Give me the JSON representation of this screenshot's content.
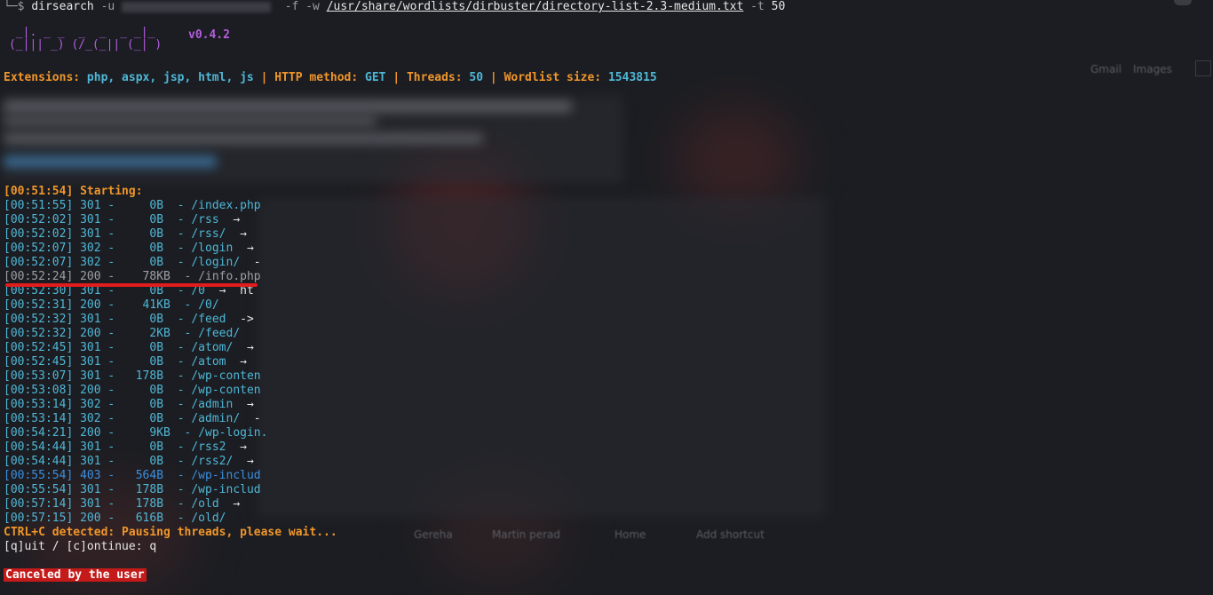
{
  "prompt": {
    "corner": "└─$",
    "command": "dirsearch",
    "flag_u": "-u",
    "flag_f": "-f",
    "flag_w": "-w",
    "wordlist_path": "/usr/share/wordlists/dirbuster/directory-list-2.3-medium.txt",
    "flag_t": "-t",
    "threads_arg": "50"
  },
  "banner": {
    "logo_line1": " _|. _ _  _  _  _ _|_",
    "logo_line2": "(_||| _) (/_(_|| (_| )",
    "version": "v0.4.2"
  },
  "config": {
    "ext_label": "Extensions:",
    "ext_value": "php, aspx, jsp, html, js",
    "sep": "|",
    "method_label": "HTTP method:",
    "method_value": "GET",
    "threads_label": "Threads:",
    "threads_value": "50",
    "wordlist_label": "Wordlist size:",
    "wordlist_value": "1543815"
  },
  "starting": "[00:51:54] Starting:",
  "results": [
    {
      "time": "[00:51:55]",
      "code": "301",
      "size": "   0B",
      "path": "/index.php",
      "tail": "",
      "color": "cyan"
    },
    {
      "time": "[00:52:02]",
      "code": "301",
      "size": "   0B",
      "path": "/rss",
      "tail": "  →",
      "color": "cyan"
    },
    {
      "time": "[00:52:02]",
      "code": "301",
      "size": "   0B",
      "path": "/rss/",
      "tail": "  →",
      "color": "cyan"
    },
    {
      "time": "[00:52:07]",
      "code": "302",
      "size": "   0B",
      "path": "/login",
      "tail": "  →",
      "color": "cyan"
    },
    {
      "time": "[00:52:07]",
      "code": "302",
      "size": "   0B",
      "path": "/login/",
      "tail": "  -",
      "color": "cyan"
    },
    {
      "time": "[00:52:24]",
      "code": "200",
      "size": "  78KB",
      "path": "/info.php",
      "tail": "",
      "color": "gray"
    },
    {
      "time": "[00:52:30]",
      "code": "301",
      "size": "   0B",
      "path": "/0",
      "tail": "  →  ht",
      "color": "cyan"
    },
    {
      "time": "[00:52:31]",
      "code": "200",
      "size": "  41KB",
      "path": "/0/",
      "tail": "",
      "color": "cyan"
    },
    {
      "time": "[00:52:32]",
      "code": "301",
      "size": "   0B",
      "path": "/feed",
      "tail": "  ->",
      "color": "cyan"
    },
    {
      "time": "[00:52:32]",
      "code": "200",
      "size": "   2KB",
      "path": "/feed/",
      "tail": "",
      "color": "cyan"
    },
    {
      "time": "[00:52:45]",
      "code": "301",
      "size": "   0B",
      "path": "/atom/",
      "tail": "  →",
      "color": "cyan"
    },
    {
      "time": "[00:52:45]",
      "code": "301",
      "size": "   0B",
      "path": "/atom",
      "tail": "  →",
      "color": "cyan"
    },
    {
      "time": "[00:53:07]",
      "code": "301",
      "size": " 178B",
      "path": "/wp-conten",
      "tail": "",
      "color": "cyan"
    },
    {
      "time": "[00:53:08]",
      "code": "200",
      "size": "   0B",
      "path": "/wp-conten",
      "tail": "",
      "color": "cyan"
    },
    {
      "time": "[00:53:14]",
      "code": "302",
      "size": "   0B",
      "path": "/admin",
      "tail": "  →",
      "color": "cyan"
    },
    {
      "time": "[00:53:14]",
      "code": "302",
      "size": "   0B",
      "path": "/admin/",
      "tail": "  -",
      "color": "cyan"
    },
    {
      "time": "[00:54:21]",
      "code": "200",
      "size": "   9KB",
      "path": "/wp-login.",
      "tail": "",
      "color": "cyan"
    },
    {
      "time": "[00:54:44]",
      "code": "301",
      "size": "   0B",
      "path": "/rss2",
      "tail": "  →",
      "color": "cyan"
    },
    {
      "time": "[00:54:44]",
      "code": "301",
      "size": "   0B",
      "path": "/rss2/",
      "tail": "  →",
      "color": "cyan"
    },
    {
      "time": "[00:55:54]",
      "code": "403",
      "size": " 564B",
      "path": "/wp-includ",
      "tail": "",
      "color": "blue"
    },
    {
      "time": "[00:55:54]",
      "code": "301",
      "size": " 178B",
      "path": "/wp-includ",
      "tail": "",
      "color": "cyan"
    },
    {
      "time": "[00:57:14]",
      "code": "301",
      "size": " 178B",
      "path": "/old",
      "tail": "  →",
      "color": "cyan"
    },
    {
      "time": "[00:57:15]",
      "code": "200",
      "size": " 616B",
      "path": "/old/",
      "tail": "",
      "color": "cyan"
    }
  ],
  "ctrlc": "CTRL+C detected: Pausing threads, please wait...",
  "prompt_quit": "[q]uit / [c]ontinue: q",
  "canceled": "Canceled by the user",
  "ghost": {
    "gmail": "Gmail",
    "images": "Images",
    "shortcuts": [
      "Gereha",
      "Martin perad",
      "Home",
      "Add shortcut"
    ]
  },
  "colors": {
    "cyan": "#4fb7d6",
    "blue": "#3b8fe0",
    "gray": "#9aa0a6",
    "orange": "#f0962a",
    "purple": "#b45ee0",
    "red": "#e11d1d"
  }
}
